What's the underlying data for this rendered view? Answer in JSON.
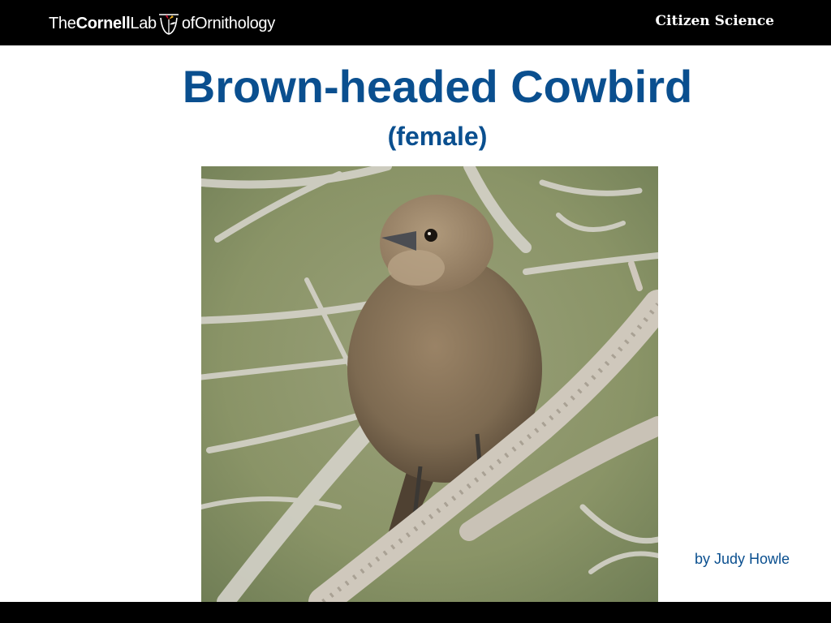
{
  "header": {
    "logo": {
      "the": "The",
      "cornell": "Cornell",
      "lab": "Lab",
      "of": "of",
      "ornithology": "Ornithology"
    },
    "program": "Citizen Science"
  },
  "slide": {
    "title": "Brown-headed Cowbird",
    "subtitle": "(female)",
    "photo_credit": "by Judy Howle"
  },
  "colors": {
    "title": "#0a4f8f",
    "bar": "#000000",
    "background": "#ffffff"
  },
  "icons": {
    "logo_mark": "cornell-bird-logo-icon"
  }
}
